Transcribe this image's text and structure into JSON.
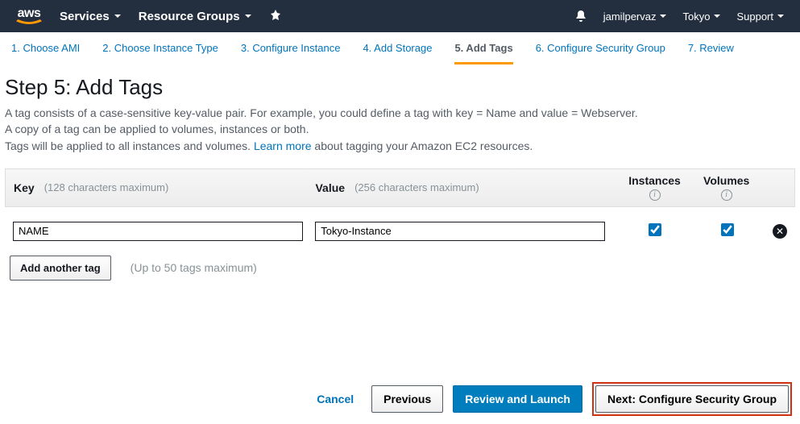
{
  "navbar": {
    "logo_text": "aws",
    "services": "Services",
    "resource_groups": "Resource Groups",
    "account": "jamilpervaz",
    "region": "Tokyo",
    "support": "Support"
  },
  "wizard": {
    "tabs": [
      "1. Choose AMI",
      "2. Choose Instance Type",
      "3. Configure Instance",
      "4. Add Storage",
      "5. Add Tags",
      "6. Configure Security Group",
      "7. Review"
    ],
    "active_index": 4
  },
  "page": {
    "title": "Step 5: Add Tags",
    "desc_line1": "A tag consists of a case-sensitive key-value pair. For example, you could define a tag with key = Name and value = Webserver.",
    "desc_line2": "A copy of a tag can be applied to volumes, instances or both.",
    "desc_line3_prefix": "Tags will be applied to all instances and volumes. ",
    "learn_more": "Learn more",
    "desc_line3_suffix": " about tagging your Amazon EC2 resources."
  },
  "table": {
    "key_label": "Key",
    "key_hint": "(128 characters maximum)",
    "value_label": "Value",
    "value_hint": "(256 characters maximum)",
    "instances_label": "Instances",
    "volumes_label": "Volumes",
    "rows": [
      {
        "key": "NAME",
        "value": "Tokyo-Instance",
        "instances": true,
        "volumes": true
      }
    ]
  },
  "add": {
    "button": "Add another tag",
    "hint": "(Up to 50 tags maximum)"
  },
  "footer": {
    "cancel": "Cancel",
    "previous": "Previous",
    "review": "Review and Launch",
    "next": "Next: Configure Security Group"
  }
}
